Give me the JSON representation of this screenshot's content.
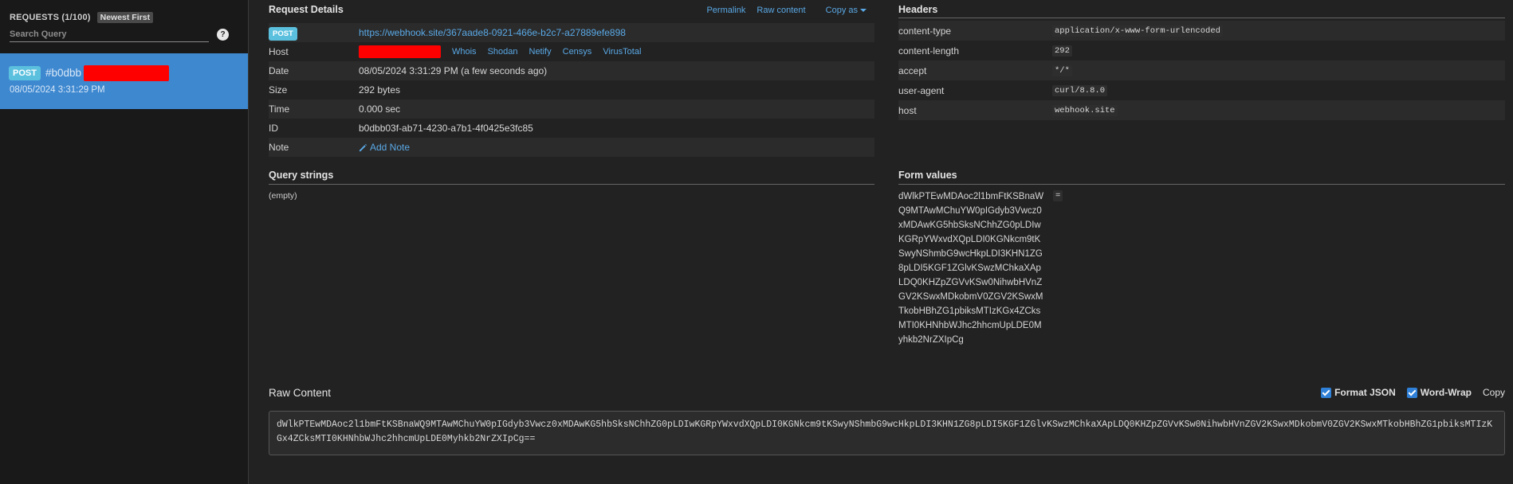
{
  "sidebar": {
    "count": "REQUESTS (1/100)",
    "sort": "Newest First",
    "search_placeholder": "Search Query",
    "help": "?",
    "request": {
      "method": "POST",
      "id_prefix": "#b0dbb",
      "date": "08/05/2024 3:31:29 PM"
    }
  },
  "details": {
    "title": "Request Details",
    "actions": {
      "permalink": "Permalink",
      "raw": "Raw content",
      "copy_as": "Copy as"
    },
    "method": "POST",
    "url": "https://webhook.site/367aade8-0921-466e-b2c7-a27889efe898",
    "rows": {
      "host": "Host",
      "date": "Date",
      "date_value": "08/05/2024 3:31:29 PM (a few seconds ago)",
      "size": "Size",
      "size_value": "292 bytes",
      "time": "Time",
      "time_value": "0.000 sec",
      "id": "ID",
      "id_value": "b0dbb03f-ab71-4230-a7b1-4f0425e3fc85",
      "note": "Note",
      "note_value": "Add Note"
    },
    "host_links": [
      "Whois",
      "Shodan",
      "Netify",
      "Censys",
      "VirusTotal"
    ]
  },
  "headers": {
    "title": "Headers",
    "items": [
      {
        "key": "content-type",
        "value": "application/x-www-form-urlencoded"
      },
      {
        "key": "content-length",
        "value": "292"
      },
      {
        "key": "accept",
        "value": "*/*"
      },
      {
        "key": "user-agent",
        "value": "curl/8.8.0"
      },
      {
        "key": "host",
        "value": "webhook.site"
      }
    ]
  },
  "query_strings": {
    "title": "Query strings",
    "empty": "(empty)"
  },
  "form_values": {
    "title": "Form values",
    "key": "dWlkPTEwMDAoc2l1bmFtKSBnaWQ9MTAwMChuYW0pIGdyb3Vwcz0xMDAwKG5hbSksNChhZG0pLDIwKGRpYWxvdXQpLDI0KGNkcm9tKSwyNShmbG9wcHkpLDI3KHN1ZG8pLDI5KGF1ZGlvKSwzMChkaXApLDQ0KHZpZGVvKSw0NihwbHVnZGV2KSwxMDkobmV0ZGV2KSwxMTkobHBhZG1pbiksMTIzKGx4ZCksMTI0KHNhbWJhc2hhcmUpLDE0Myhkb2NrZXIpCg",
    "value": "="
  },
  "raw": {
    "title": "Raw Content",
    "format_json": "Format JSON",
    "word_wrap": "Word-Wrap",
    "copy": "Copy",
    "content": "dWlkPTEwMDAoc2l1bmFtKSBnaWQ9MTAwMChuYW0pIGdyb3Vwcz0xMDAwKG5hbSksNChhZG0pLDIwKGRpYWxvdXQpLDI0KGNkcm9tKSwyNShmbG9wcHkpLDI3KHN1ZG8pLDI5KGF1ZGlvKSwzMChkaXApLDQ0KHZpZGVvKSw0NihwbHVnZGV2KSwxMDkobmV0ZGV2KSwxMTkobHBhZG1pbiksMTIzKGx4ZCksMTI0KHNhbWJhc2hhcmUpLDE0Myhkb2NrZXIpCg=="
  },
  "colors": {
    "accent": "#3e88d0",
    "badge": "#5bc0de",
    "link": "#5aa9e6",
    "redaction": "#ff0000"
  }
}
